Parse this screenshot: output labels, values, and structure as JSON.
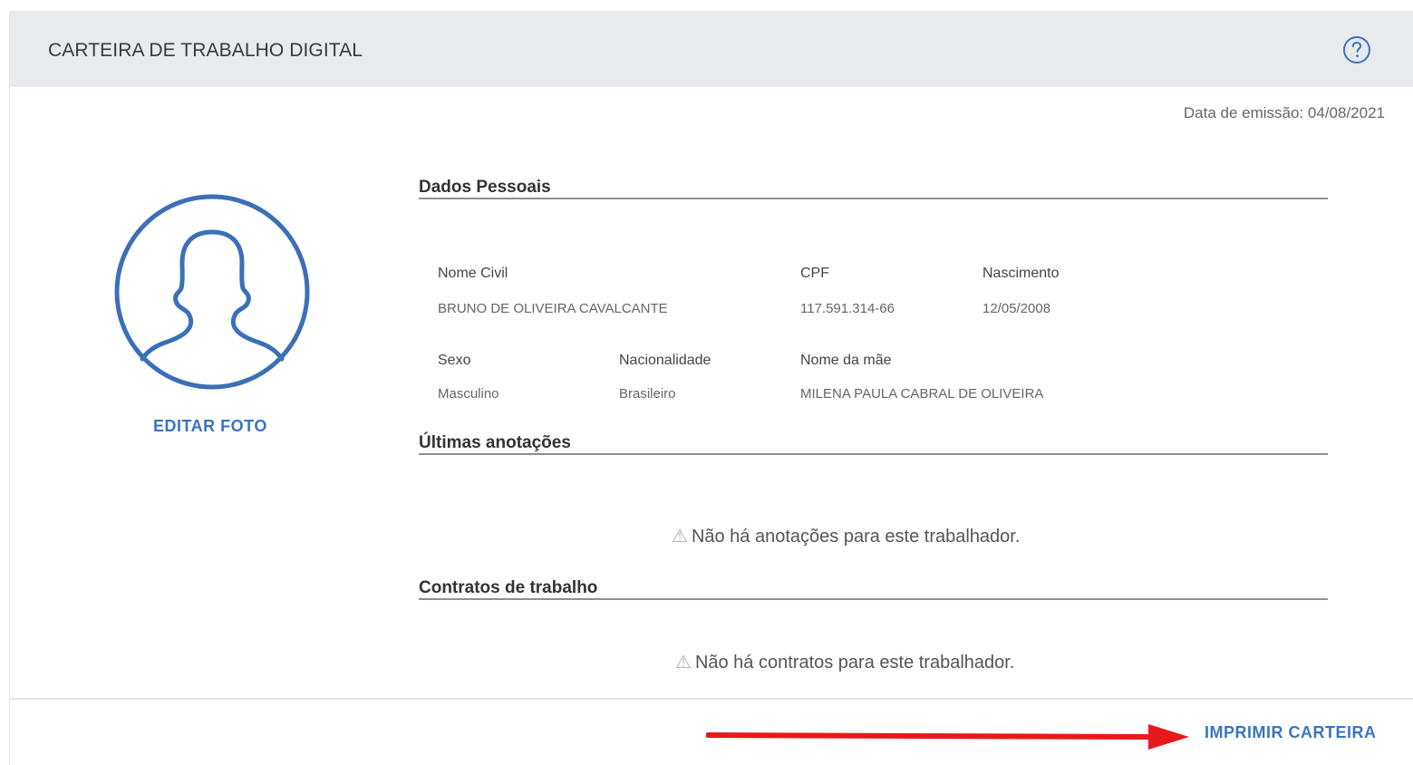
{
  "header": {
    "title": "CARTEIRA DE TRABALHO DIGITAL",
    "help_icon": "question-circle-icon"
  },
  "issue_date": "Data de emissão: 04/08/2021",
  "profile": {
    "avatar_icon": "user-avatar-icon",
    "edit_photo_label": "EDITAR FOTO"
  },
  "personal_data": {
    "title": "Dados Pessoais",
    "fields": {
      "nome_civil": {
        "label": "Nome Civil",
        "value": "BRUNO DE OLIVEIRA CAVALCANTE"
      },
      "cpf": {
        "label": "CPF",
        "value": "117.591.314-66"
      },
      "nascimento": {
        "label": "Nascimento",
        "value": "12/05/2008"
      },
      "sexo": {
        "label": "Sexo",
        "value": "Masculino"
      },
      "nacionalidade": {
        "label": "Nacionalidade",
        "value": "Brasileiro"
      },
      "nome_mae": {
        "label": "Nome da mãe",
        "value": "MILENA PAULA CABRAL DE OLIVEIRA"
      }
    }
  },
  "annotations": {
    "title": "Últimas anotações",
    "empty_icon": "warning-icon",
    "empty_message": "Não há anotações para este trabalhador."
  },
  "contracts": {
    "title": "Contratos de trabalho",
    "empty_icon": "warning-icon",
    "empty_message": "Não há contratos para este trabalhador."
  },
  "footer": {
    "print_label": "IMPRIMIR CARTEIRA",
    "arrow_color": "#e8191b"
  },
  "colors": {
    "accent": "#3b74c2",
    "header_bg": "#e8eaed",
    "arrow": "#e8191b"
  }
}
